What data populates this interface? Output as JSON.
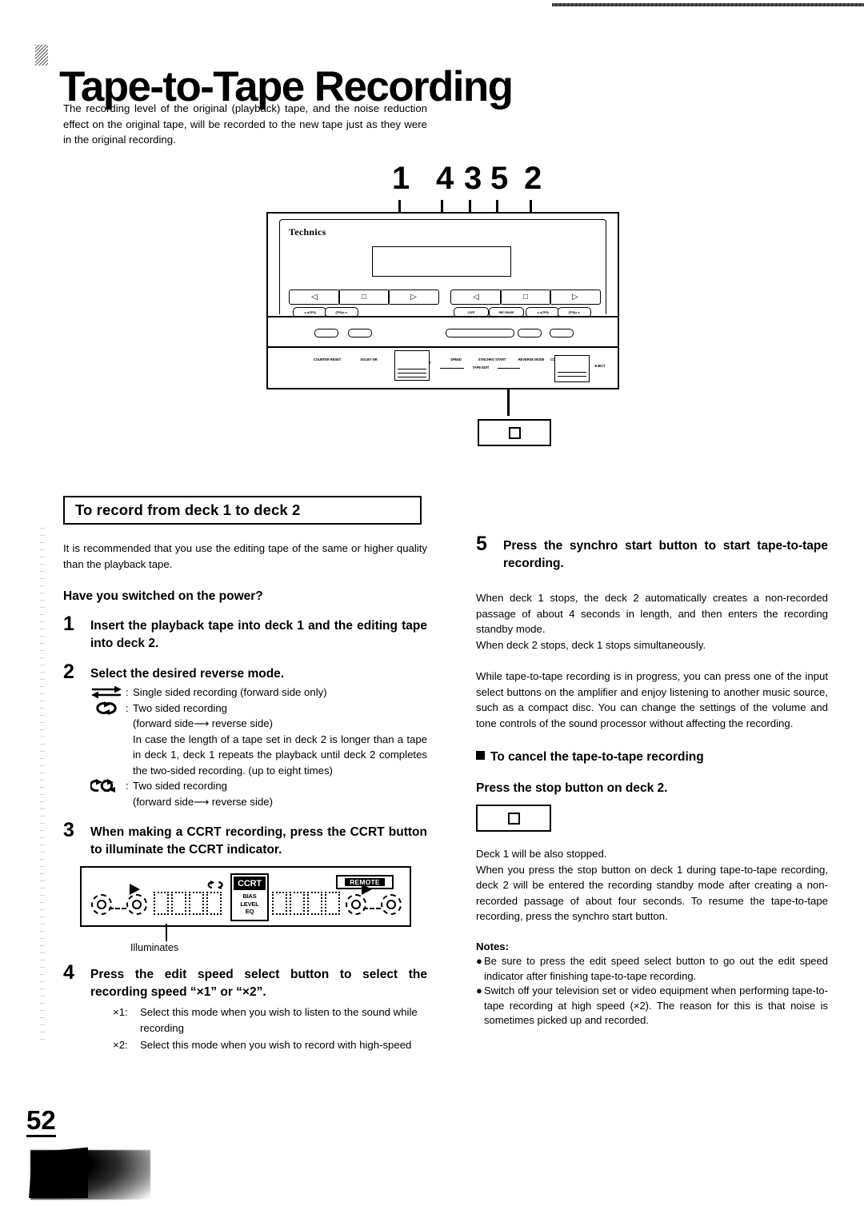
{
  "page": {
    "title": "Tape-to-Tape Recording",
    "number": "52",
    "intro": "The recording level of the original (playback) tape, and the noise reduction effect on the original tape, will be recorded to the new tape just as they were in the original recording."
  },
  "diagram": {
    "callouts": [
      "1",
      "4",
      "3",
      "5",
      "2"
    ],
    "brand": "Technics",
    "deck1": {
      "transport": [
        "reverse-play-icon",
        "stop-icon",
        "play-icon"
      ],
      "sub_buttons": [
        "◄◄(TPS)",
        "(TPS)►►"
      ],
      "labels": [
        "COUNTER RESET",
        "DOLBY NR",
        "EJECT"
      ]
    },
    "deck2": {
      "transport": [
        "reverse-play-icon",
        "stop-icon",
        "play-icon"
      ],
      "sub_buttons": [
        "CCRT",
        "REC PAUSE",
        "◄◄(TPS)",
        "(TPS)►►"
      ],
      "labels": [
        "SPEED",
        "SYNCHRO START",
        "TAPE EDIT",
        "REVERSE MODE",
        "COUNTER RESET",
        "EJECT"
      ]
    },
    "stop_callout_icon": "stop-square-icon"
  },
  "section": {
    "heading": "To record from deck 1 to deck 2",
    "recommend": "It is recommended that you use the editing tape of the same or higher quality than the playback tape.",
    "power_question": "Have you switched on the power?"
  },
  "steps": [
    {
      "num": "1",
      "text": "Insert the playback tape into deck 1 and the editing tape into deck 2."
    },
    {
      "num": "2",
      "text": "Select the desired reverse mode.",
      "modes": [
        {
          "symbol": "single-sided-arrows-icon",
          "label": "Single sided recording (forward side only)"
        },
        {
          "symbol": "two-sided-loop-icon",
          "label": "Two sided recording",
          "detail": "(forward side⟶ reverse side)",
          "note": "In case the length of a tape set in deck 2 is longer than a tape in deck 1, deck 1 repeats the playback until deck 2 completes the two-sided recording. (up to eight times)"
        },
        {
          "symbol": "double-loop-icon",
          "label": "Two sided recording",
          "detail": "(forward side⟶ reverse side)"
        }
      ]
    },
    {
      "num": "3",
      "text": "When making a CCRT recording, press the CCRT button to illuminate the CCRT indicator.",
      "panel": {
        "ccrt_label": "CCRT",
        "ccrt_sub": [
          "BIAS",
          "LEVEL",
          "EQ"
        ],
        "remote_label": "REMOTE",
        "illuminates_label": "Illuminates"
      }
    },
    {
      "num": "4",
      "text": "Press the edit speed select button to select the recording speed “×1” or “×2”.",
      "speeds": [
        {
          "key": "×1:",
          "value": "Select this mode when you wish to listen to the sound while recording"
        },
        {
          "key": "×2:",
          "value": "Select this mode when you wish to record with high-speed"
        }
      ]
    },
    {
      "num": "5",
      "text": "Press the synchro start button to start tape-to-tape recording."
    }
  ],
  "right": {
    "after_step5": [
      "When deck 1 stops, the deck 2 automatically creates a non-recorded passage of about 4 seconds in length, and then enters the recording standby mode.",
      "When deck 2 stops, deck 1 stops simultaneously."
    ],
    "while_recording": "While tape-to-tape recording is in progress, you can press one of the input select buttons on the amplifier and enjoy listening to another music source, such as a compact disc. You can change the settings of the volume and tone controls of the sound processor without affecting the recording.",
    "cancel_heading": "To cancel the tape-to-tape recording",
    "cancel_action": "Press the stop button on deck 2.",
    "cancel_icon": "stop-square-icon",
    "cancel_body": [
      "Deck 1 will be also stopped.",
      "When you press the stop button on deck 1 during tape-to-tape recording, deck 2 will be entered the recording standby mode after creating a non-recorded passage of about four seconds. To resume the tape-to-tape recording, press the synchro start button."
    ],
    "notes_title": "Notes:",
    "notes": [
      "Be sure to press the edit speed select button to go out the edit speed indicator after finishing tape-to-tape recording.",
      "Switch off your television set or video equipment when performing tape-to-tape recording at high speed (×2). The reason for this is that noise is sometimes picked up and recorded."
    ]
  }
}
